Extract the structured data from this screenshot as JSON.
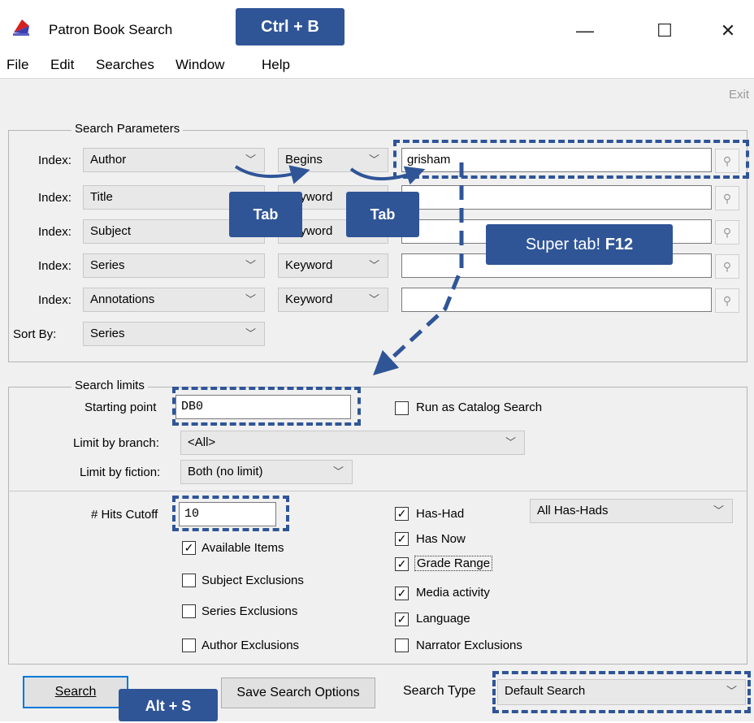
{
  "window": {
    "title": "Patron Book Search",
    "minimize": "—",
    "maximize": "☐",
    "close": "✕"
  },
  "menu": [
    "File",
    "Edit",
    "Searches",
    "Window",
    "Help"
  ],
  "toolbar": {
    "exit_label": "Exit"
  },
  "search_parameters": {
    "legend": "Search Parameters",
    "index_label": "Index:",
    "rows": [
      {
        "index": "Author",
        "mode": "Begins",
        "value": "grisham"
      },
      {
        "index": "Title",
        "mode": "Keyword",
        "value": ""
      },
      {
        "index": "Subject",
        "mode": "Keyword",
        "value": ""
      },
      {
        "index": "Series",
        "mode": "Keyword",
        "value": ""
      },
      {
        "index": "Annotations",
        "mode": "Keyword",
        "value": ""
      }
    ],
    "sort_label": "Sort By:",
    "sort_value": "Series"
  },
  "search_limits": {
    "legend": "Search limits",
    "starting_point_label": "Starting point",
    "starting_point_value": "DB0",
    "run_catalog_label": "Run as Catalog Search",
    "run_catalog_checked": false,
    "branch_label": "Limit by branch:",
    "branch_value": "<All>",
    "fiction_label": "Limit by fiction:",
    "fiction_value": "Both (no limit)"
  },
  "options": {
    "hits_label": "# Hits Cutoff",
    "hits_value": "10",
    "left_checks": [
      {
        "label": "Available Items",
        "checked": true
      },
      {
        "label": "Subject Exclusions",
        "checked": false
      },
      {
        "label": "Series Exclusions",
        "checked": false
      },
      {
        "label": "Author Exclusions",
        "checked": false
      }
    ],
    "right_checks": [
      {
        "label": "Has-Had",
        "checked": true
      },
      {
        "label": "Has Now",
        "checked": true
      },
      {
        "label": "Grade Range",
        "checked": true
      },
      {
        "label": "Media activity",
        "checked": true
      },
      {
        "label": "Language",
        "checked": true
      },
      {
        "label": "Narrator Exclusions",
        "checked": false
      }
    ],
    "has_had_value": "All Has-Hads"
  },
  "footer": {
    "search_button": "Search",
    "save_button": "Save Search Options",
    "search_type_label": "Search Type",
    "search_type_value": "Default Search"
  },
  "callouts": {
    "ctrl_b": "Ctrl + B",
    "tab1": "Tab",
    "tab2": "Tab",
    "super_tab_text": "Super tab!",
    "super_tab_key": "F12",
    "alt_s": "Alt + S"
  },
  "colors": {
    "callout": "#2f5597",
    "panel": "#f0f0f0"
  }
}
